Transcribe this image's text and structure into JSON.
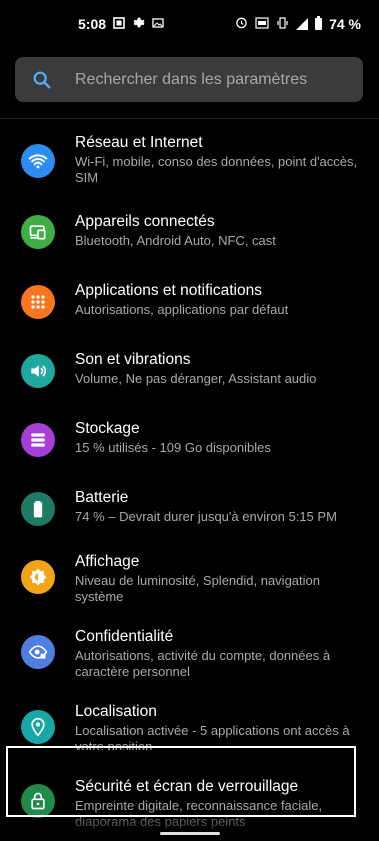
{
  "status_bar": {
    "time": "5:08",
    "battery": "74 %"
  },
  "search": {
    "placeholder": "Rechercher dans les paramètres"
  },
  "settings": [
    {
      "title": "Réseau et Internet",
      "subtitle": "Wi-Fi, mobile, conso des données, point d'accès, SIM",
      "icon": "wifi-icon",
      "color": "#2d8cf0"
    },
    {
      "title": "Appareils connectés",
      "subtitle": "Bluetooth, Android Auto, NFC, cast",
      "icon": "connected-devices-icon",
      "color": "#3fae49"
    },
    {
      "title": "Applications et notifications",
      "subtitle": "Autorisations, applications par défaut",
      "icon": "apps-grid-icon",
      "color": "#f7761f"
    },
    {
      "title": "Son et vibrations",
      "subtitle": "Volume, Ne pas déranger, Assistant audio",
      "icon": "volume-icon",
      "color": "#1fa7a0"
    },
    {
      "title": "Stockage",
      "subtitle": "15 % utilisés - 109 Go disponibles",
      "icon": "storage-icon",
      "color": "#a63fd8"
    },
    {
      "title": "Batterie",
      "subtitle": "74 % – Devrait durer jusqu'à environ 5:15 PM",
      "icon": "battery-icon",
      "color": "#1f7a64"
    },
    {
      "title": "Affichage",
      "subtitle": "Niveau de luminosité, Splendid, navigation système",
      "icon": "brightness-icon",
      "color": "#f2a41b"
    },
    {
      "title": "Confidentialité",
      "subtitle": "Autorisations, activité du compte, données à caractère personnel",
      "icon": "privacy-eye-icon",
      "color": "#4f7de0"
    },
    {
      "title": "Localisation",
      "subtitle": "Localisation activée - 5 applications ont accès à votre position",
      "icon": "location-pin-icon",
      "color": "#1aa6a6"
    },
    {
      "title": "Sécurité et écran de verrouillage",
      "subtitle": "Empreinte digitale, reconnaissance faciale, diaporama des papiers peints",
      "icon": "lock-icon",
      "color": "#1f8a4a"
    }
  ]
}
